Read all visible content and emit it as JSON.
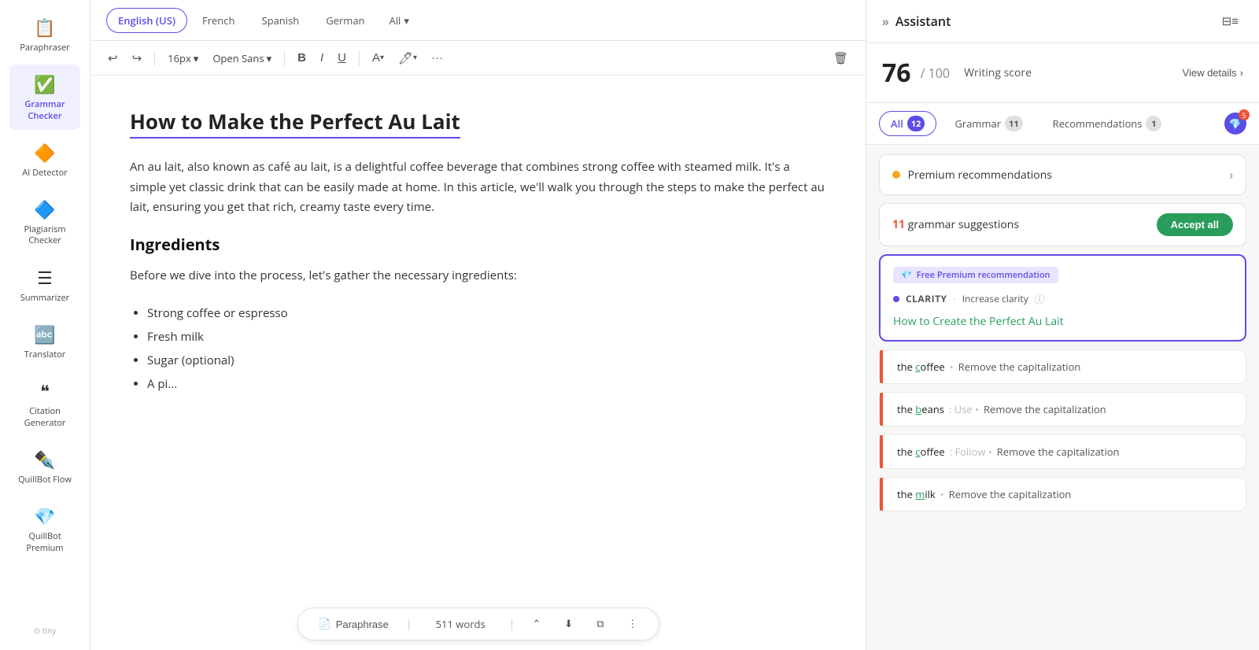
{
  "sidebar": {
    "items": [
      {
        "id": "paraphraser",
        "label": "Paraphraser",
        "icon": "📋",
        "active": false
      },
      {
        "id": "grammar-checker",
        "label": "Grammar Checker",
        "icon": "✅",
        "active": true
      },
      {
        "id": "ai-detector",
        "label": "AI Detector",
        "icon": "🔶",
        "active": false
      },
      {
        "id": "plagiarism-checker",
        "label": "Plagiarism Checker",
        "icon": "🔷",
        "active": false
      },
      {
        "id": "summarizer",
        "label": "Summarizer",
        "icon": "☰",
        "active": false
      },
      {
        "id": "translator",
        "label": "Translator",
        "icon": "🔤",
        "active": false
      },
      {
        "id": "citation-generator",
        "label": "Citation Generator",
        "icon": "❝",
        "active": false
      },
      {
        "id": "quillbot-flow",
        "label": "QuillBot Flow",
        "icon": "✒️",
        "active": false
      },
      {
        "id": "quillbot-premium",
        "label": "QuillBot Premium",
        "icon": "💎",
        "active": false
      }
    ]
  },
  "lang_bar": {
    "tabs": [
      {
        "label": "English (US)",
        "active": true
      },
      {
        "label": "French",
        "active": false
      },
      {
        "label": "Spanish",
        "active": false
      },
      {
        "label": "German",
        "active": false
      }
    ],
    "all_label": "All"
  },
  "toolbar": {
    "font_size": "16px",
    "font_family": "Open Sans",
    "bold": "B",
    "italic": "I",
    "underline": "U"
  },
  "editor": {
    "title": "How to Make the Perfect Au Lait",
    "body": "An au lait, also known as café au lait, is a delightful coffee beverage that combines strong coffee with steamed milk. It's a simple yet classic drink that can be easily made at home. In this article, we'll walk you through the steps to make the perfect au lait, ensuring you get that rich, creamy taste every time.",
    "section_title": "Ingredients",
    "section_body": "Before we dive into the process, let's gather the necessary ingredients:",
    "bullets": [
      "Strong coffee or espresso",
      "Fresh milk",
      "Sugar (optional)",
      "A pi..."
    ]
  },
  "bottom_bar": {
    "paraphrase_label": "Paraphrase",
    "word_count": "511 words"
  },
  "assistant": {
    "title": "Assistant",
    "score": "76",
    "score_total": "/ 100",
    "score_label": "Writing score",
    "view_details": "View details",
    "tabs": [
      {
        "label": "All",
        "count": "12",
        "active": true
      },
      {
        "label": "Grammar",
        "count": "11",
        "active": false
      },
      {
        "label": "Recommendations",
        "count": "1",
        "active": false
      }
    ],
    "premium_rec_label": "Premium recommendations",
    "grammar_count": "11",
    "grammar_label": "grammar",
    "grammar_suffix": "suggestions",
    "accept_all": "Accept all",
    "free_premium_badge": "Free Premium recommendation",
    "clarity_label": "CLARITY",
    "clarity_action": "Increase clarity",
    "suggestion_text": "How to Create the Perfect Au Lait",
    "suggestions": [
      {
        "main": "the coffee",
        "sep": "•",
        "action": "Remove the capitalization"
      },
      {
        "main": "the beans",
        "highlight": "b",
        "sep": ": Use •",
        "action": "Remove the capitalization"
      },
      {
        "main": "the coffee",
        "sep": ": Follow •",
        "action": "Remove the capitalization"
      },
      {
        "main": "the milk",
        "sep": "•",
        "action": "Remove the capitalization"
      }
    ]
  },
  "tiny_logo": "⊙ tiny"
}
